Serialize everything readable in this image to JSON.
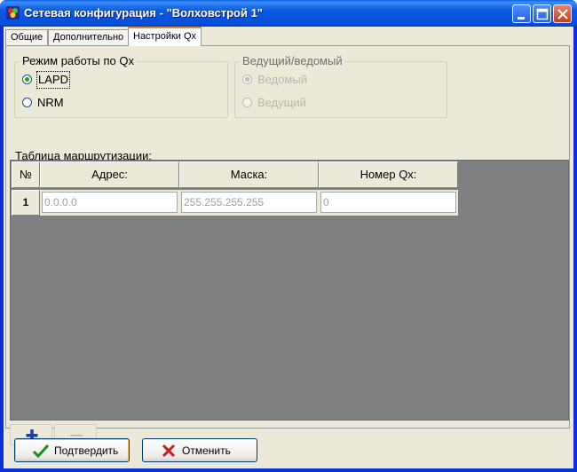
{
  "window": {
    "title": "Сетевая конфигурация - \"Волховстрой 1\""
  },
  "tabs": [
    {
      "label": "Общие"
    },
    {
      "label": "Дополнительно"
    },
    {
      "label": "Настройки Qx"
    }
  ],
  "mode_group": {
    "title": "Режим работы по Qx",
    "options": [
      {
        "label": "LAPD",
        "selected": true
      },
      {
        "label": "NRM",
        "selected": false
      }
    ]
  },
  "master_group": {
    "title": "Ведущий/ведомый",
    "options": [
      {
        "label": "Ведомый",
        "selected": true,
        "disabled": true
      },
      {
        "label": "Ведущий",
        "selected": false,
        "disabled": true
      }
    ]
  },
  "routing": {
    "caption": "Таблица маршрутизации:",
    "columns": [
      "№",
      "Адрес:",
      "Маска:",
      "Номер Qx:"
    ],
    "rows": [
      {
        "num": "1",
        "address": "0.0.0.0",
        "mask": "255.255.255.255",
        "qx": "0"
      }
    ]
  },
  "buttons": {
    "confirm_label": "Подтвердить",
    "cancel_label": "Отменить"
  },
  "icons": {
    "add": "plus-icon",
    "remove": "minus-icon",
    "confirm": "checkmark-icon",
    "cancel": "x-icon"
  },
  "colors": {
    "titlebar": "#0550dc",
    "grid_background": "#808080",
    "check_green": "#1f8a1f",
    "cancel_red": "#c81e1e",
    "add_blue": "#1c3fb8"
  }
}
